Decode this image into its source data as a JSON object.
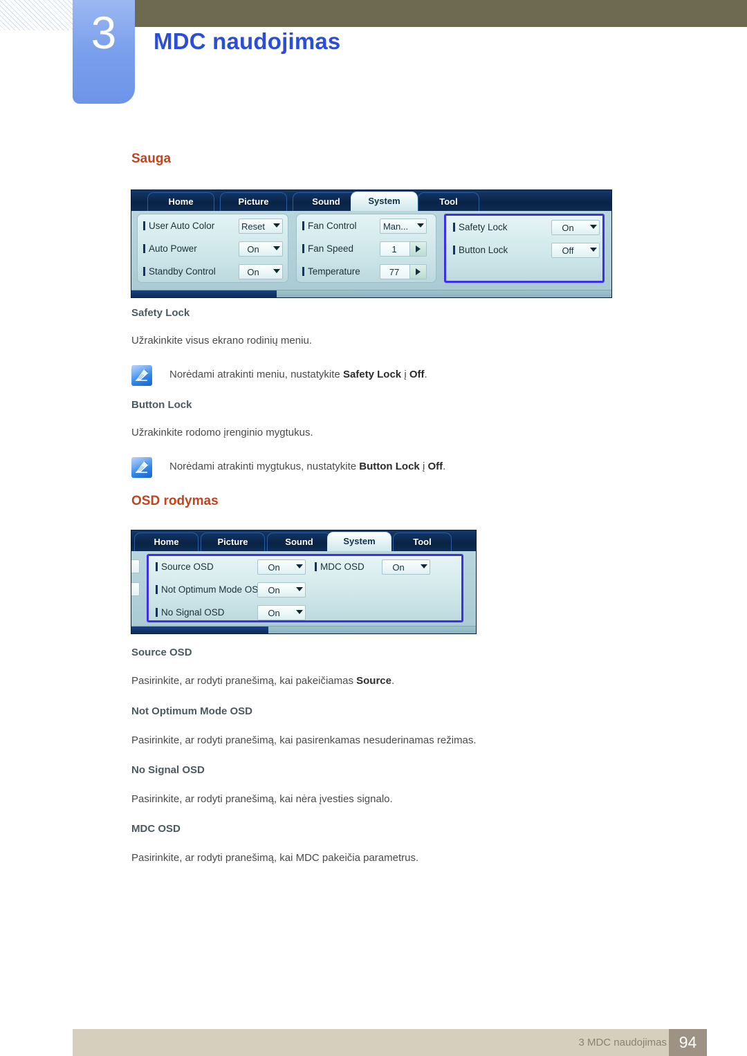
{
  "header": {
    "chapter_number": "3",
    "chapter_title": "MDC naudojimas"
  },
  "colors": {
    "section_heading": "#c4431c",
    "sub_heading": "#4b5a61",
    "chapter_title": "#2b4ed6",
    "olive_bar": "#6e6a52",
    "chapter_tab": "#7aa0ec",
    "footer_bar": "#d6cfbd",
    "footer_page_box": "#9d9284",
    "mdc_highlight": "#3a2ef0"
  },
  "sections": [
    {
      "heading": "Sauga",
      "screenshot": {
        "tabs": [
          {
            "label": "Home",
            "active": false
          },
          {
            "label": "Picture",
            "active": false
          },
          {
            "label": "Sound",
            "active": false
          },
          {
            "label": "System",
            "active": true
          },
          {
            "label": "Tool",
            "active": false
          }
        ],
        "panels": [
          {
            "highlighted": false,
            "rows": [
              {
                "label": "User Auto Color",
                "value": "Reset",
                "control": "dropdown"
              },
              {
                "label": "Auto Power",
                "value": "On",
                "control": "dropdown"
              },
              {
                "label": "Standby Control",
                "value": "On",
                "control": "dropdown"
              }
            ]
          },
          {
            "highlighted": false,
            "rows": [
              {
                "label": "Fan Control",
                "value": "Man...",
                "control": "dropdown"
              },
              {
                "label": "Fan Speed",
                "value": "1",
                "control": "spinner"
              },
              {
                "label": "Temperature",
                "value": "77",
                "control": "spinner"
              }
            ]
          },
          {
            "highlighted": true,
            "rows": [
              {
                "label": "Safety Lock",
                "value": "On",
                "control": "dropdown"
              },
              {
                "label": "Button Lock",
                "value": "Off",
                "control": "dropdown"
              }
            ]
          }
        ]
      },
      "items": [
        {
          "title": "Safety Lock",
          "body": "Užrakinkite visus ekrano rodinių meniu.",
          "note": {
            "icon": "note-pencil-icon",
            "prefix": "Norėdami atrakinti meniu, nustatykite ",
            "bold1": "Safety Lock",
            "mid": " į ",
            "bold2": "Off",
            "suffix": "."
          }
        },
        {
          "title": "Button Lock",
          "body": "Užrakinkite rodomo įrenginio mygtukus.",
          "note": {
            "icon": "note-pencil-icon",
            "prefix": "Norėdami atrakinti mygtukus, nustatykite ",
            "bold1": "Button Lock",
            "mid": " į ",
            "bold2": "Off",
            "suffix": "."
          }
        }
      ]
    },
    {
      "heading": "OSD rodymas",
      "screenshot": {
        "tabs": [
          {
            "label": "Home",
            "active": false
          },
          {
            "label": "Picture",
            "active": false
          },
          {
            "label": "Sound",
            "active": false
          },
          {
            "label": "System",
            "active": true
          },
          {
            "label": "Tool",
            "active": false
          }
        ],
        "panels": [
          {
            "highlighted": true,
            "rows": [
              {
                "label": "Source OSD",
                "value": "On",
                "control": "dropdown"
              },
              {
                "label": "Not Optimum Mode OSD",
                "value": "On",
                "control": "dropdown"
              },
              {
                "label": "No Signal OSD",
                "value": "On",
                "control": "dropdown"
              },
              {
                "label": "MDC OSD",
                "value": "On",
                "control": "dropdown"
              }
            ]
          }
        ]
      },
      "items": [
        {
          "title": "Source OSD",
          "body_prefix": "Pasirinkite, ar rodyti pranešimą, kai pakeičiamas ",
          "body_bold": "Source",
          "body_suffix": "."
        },
        {
          "title": "Not Optimum Mode OSD",
          "body": "Pasirinkite, ar rodyti pranešimą, kai pasirenkamas nesuderinamas režimas."
        },
        {
          "title": "No Signal OSD",
          "body": "Pasirinkite, ar rodyti pranešimą, kai nėra įvesties signalo."
        },
        {
          "title": "MDC OSD",
          "body": "Pasirinkite, ar rodyti pranešimą, kai MDC pakeičia parametrus."
        }
      ]
    }
  ],
  "footer": {
    "label": "3 MDC naudojimas",
    "page": "94"
  }
}
